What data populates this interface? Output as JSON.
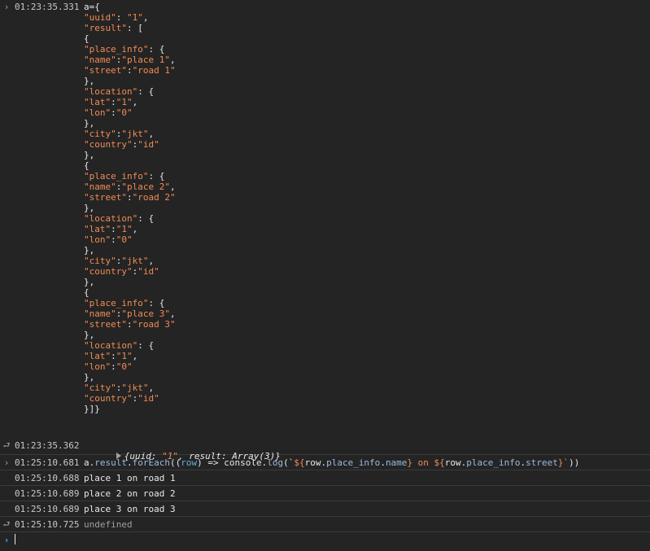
{
  "console": {
    "input1": {
      "timestamp": "01:23:35.331",
      "lines": [
        [
          {
            "t": "a={",
            "c": "v"
          }
        ],
        [
          {
            "t": "\"uuid\"",
            "c": "s"
          },
          {
            "t": ": ",
            "c": "v"
          },
          {
            "t": "\"1\"",
            "c": "s"
          },
          {
            "t": ",",
            "c": "v"
          }
        ],
        [
          {
            "t": "\"result\"",
            "c": "s"
          },
          {
            "t": ": [",
            "c": "v"
          }
        ],
        [
          {
            "t": "{",
            "c": "v"
          }
        ],
        [
          {
            "t": "\"place_info\"",
            "c": "s"
          },
          {
            "t": ": {",
            "c": "v"
          }
        ],
        [
          {
            "t": "\"name\"",
            "c": "s"
          },
          {
            "t": ":",
            "c": "v"
          },
          {
            "t": "\"place 1\"",
            "c": "s"
          },
          {
            "t": ",",
            "c": "v"
          }
        ],
        [
          {
            "t": "\"street\"",
            "c": "s"
          },
          {
            "t": ":",
            "c": "v"
          },
          {
            "t": "\"road 1\"",
            "c": "s"
          }
        ],
        [
          {
            "t": "},",
            "c": "v"
          }
        ],
        [
          {
            "t": "\"location\"",
            "c": "s"
          },
          {
            "t": ": {",
            "c": "v"
          }
        ],
        [
          {
            "t": "\"lat\"",
            "c": "s"
          },
          {
            "t": ":",
            "c": "v"
          },
          {
            "t": "\"1\"",
            "c": "s"
          },
          {
            "t": ",",
            "c": "v"
          }
        ],
        [
          {
            "t": "\"lon\"",
            "c": "s"
          },
          {
            "t": ":",
            "c": "v"
          },
          {
            "t": "\"0\"",
            "c": "s"
          }
        ],
        [
          {
            "t": "},",
            "c": "v"
          }
        ],
        [
          {
            "t": "\"city\"",
            "c": "s"
          },
          {
            "t": ":",
            "c": "v"
          },
          {
            "t": "\"jkt\"",
            "c": "s"
          },
          {
            "t": ",",
            "c": "v"
          }
        ],
        [
          {
            "t": "\"country\"",
            "c": "s"
          },
          {
            "t": ":",
            "c": "v"
          },
          {
            "t": "\"id\"",
            "c": "s"
          }
        ],
        [
          {
            "t": "},",
            "c": "v"
          }
        ],
        [
          {
            "t": "{",
            "c": "v"
          }
        ],
        [
          {
            "t": "\"place_info\"",
            "c": "s"
          },
          {
            "t": ": {",
            "c": "v"
          }
        ],
        [
          {
            "t": "\"name\"",
            "c": "s"
          },
          {
            "t": ":",
            "c": "v"
          },
          {
            "t": "\"place 2\"",
            "c": "s"
          },
          {
            "t": ",",
            "c": "v"
          }
        ],
        [
          {
            "t": "\"street\"",
            "c": "s"
          },
          {
            "t": ":",
            "c": "v"
          },
          {
            "t": "\"road 2\"",
            "c": "s"
          }
        ],
        [
          {
            "t": "},",
            "c": "v"
          }
        ],
        [
          {
            "t": "\"location\"",
            "c": "s"
          },
          {
            "t": ": {",
            "c": "v"
          }
        ],
        [
          {
            "t": "\"lat\"",
            "c": "s"
          },
          {
            "t": ":",
            "c": "v"
          },
          {
            "t": "\"1\"",
            "c": "s"
          },
          {
            "t": ",",
            "c": "v"
          }
        ],
        [
          {
            "t": "\"lon\"",
            "c": "s"
          },
          {
            "t": ":",
            "c": "v"
          },
          {
            "t": "\"0\"",
            "c": "s"
          }
        ],
        [
          {
            "t": "},",
            "c": "v"
          }
        ],
        [
          {
            "t": "\"city\"",
            "c": "s"
          },
          {
            "t": ":",
            "c": "v"
          },
          {
            "t": "\"jkt\"",
            "c": "s"
          },
          {
            "t": ",",
            "c": "v"
          }
        ],
        [
          {
            "t": "\"country\"",
            "c": "s"
          },
          {
            "t": ":",
            "c": "v"
          },
          {
            "t": "\"id\"",
            "c": "s"
          }
        ],
        [
          {
            "t": "},",
            "c": "v"
          }
        ],
        [
          {
            "t": "{",
            "c": "v"
          }
        ],
        [
          {
            "t": "\"place_info\"",
            "c": "s"
          },
          {
            "t": ": {",
            "c": "v"
          }
        ],
        [
          {
            "t": "\"name\"",
            "c": "s"
          },
          {
            "t": ":",
            "c": "v"
          },
          {
            "t": "\"place 3\"",
            "c": "s"
          },
          {
            "t": ",",
            "c": "v"
          }
        ],
        [
          {
            "t": "\"street\"",
            "c": "s"
          },
          {
            "t": ":",
            "c": "v"
          },
          {
            "t": "\"road 3\"",
            "c": "s"
          }
        ],
        [
          {
            "t": "},",
            "c": "v"
          }
        ],
        [
          {
            "t": "\"location\"",
            "c": "s"
          },
          {
            "t": ": {",
            "c": "v"
          }
        ],
        [
          {
            "t": "\"lat\"",
            "c": "s"
          },
          {
            "t": ":",
            "c": "v"
          },
          {
            "t": "\"1\"",
            "c": "s"
          },
          {
            "t": ",",
            "c": "v"
          }
        ],
        [
          {
            "t": "\"lon\"",
            "c": "s"
          },
          {
            "t": ":",
            "c": "v"
          },
          {
            "t": "\"0\"",
            "c": "s"
          }
        ],
        [
          {
            "t": "},",
            "c": "v"
          }
        ],
        [
          {
            "t": "\"city\"",
            "c": "s"
          },
          {
            "t": ":",
            "c": "v"
          },
          {
            "t": "\"jkt\"",
            "c": "s"
          },
          {
            "t": ",",
            "c": "v"
          }
        ],
        [
          {
            "t": "\"country\"",
            "c": "s"
          },
          {
            "t": ":",
            "c": "v"
          },
          {
            "t": "\"id\"",
            "c": "s"
          }
        ],
        [
          {
            "t": "}]}",
            "c": "v"
          }
        ]
      ]
    },
    "result1": {
      "timestamp": "01:23:35.362",
      "parts": [
        {
          "t": "{uuid: ",
          "c": "obj-key"
        },
        {
          "t": "\"1\"",
          "c": "obj-str"
        },
        {
          "t": ", result: Array(3)}",
          "c": "obj-key"
        }
      ]
    },
    "input2": {
      "timestamp": "01:25:10.681",
      "parts": [
        {
          "t": "a.",
          "c": "fn"
        },
        {
          "t": "result",
          "c": "prop"
        },
        {
          "t": ".",
          "c": "fn"
        },
        {
          "t": "forEach",
          "c": "prop"
        },
        {
          "t": "((",
          "c": "fn"
        },
        {
          "t": "row",
          "c": "arg"
        },
        {
          "t": ") => console.",
          "c": "fn"
        },
        {
          "t": "log",
          "c": "prop"
        },
        {
          "t": "(`",
          "c": "fn"
        },
        {
          "t": "${",
          "c": "tmpl"
        },
        {
          "t": "row.",
          "c": "fn"
        },
        {
          "t": "place_info",
          "c": "prop"
        },
        {
          "t": ".",
          "c": "fn"
        },
        {
          "t": "name",
          "c": "prop"
        },
        {
          "t": "} on ${",
          "c": "tmpl"
        },
        {
          "t": "row.",
          "c": "fn"
        },
        {
          "t": "place_info",
          "c": "prop"
        },
        {
          "t": ".",
          "c": "fn"
        },
        {
          "t": "street",
          "c": "prop"
        },
        {
          "t": "}`",
          "c": "tmpl"
        },
        {
          "t": "))",
          "c": "fn"
        }
      ]
    },
    "logs": [
      {
        "timestamp": "01:25:10.688",
        "text": "place 1 on road 1"
      },
      {
        "timestamp": "01:25:10.689",
        "text": "place 2 on road 2"
      },
      {
        "timestamp": "01:25:10.689",
        "text": "place 3 on road 3"
      }
    ],
    "result2": {
      "timestamp": "01:25:10.725",
      "text": "undefined"
    },
    "icons": {
      "input": "chevron-right-icon",
      "output": "return-arrow-icon",
      "prompt": "prompt-chevron-icon"
    },
    "colors": {
      "background": "#242424",
      "string": "#f28b54",
      "property": "#9bbbdc",
      "argument": "#5db0d7",
      "prompt": "#4aa3ff"
    }
  }
}
